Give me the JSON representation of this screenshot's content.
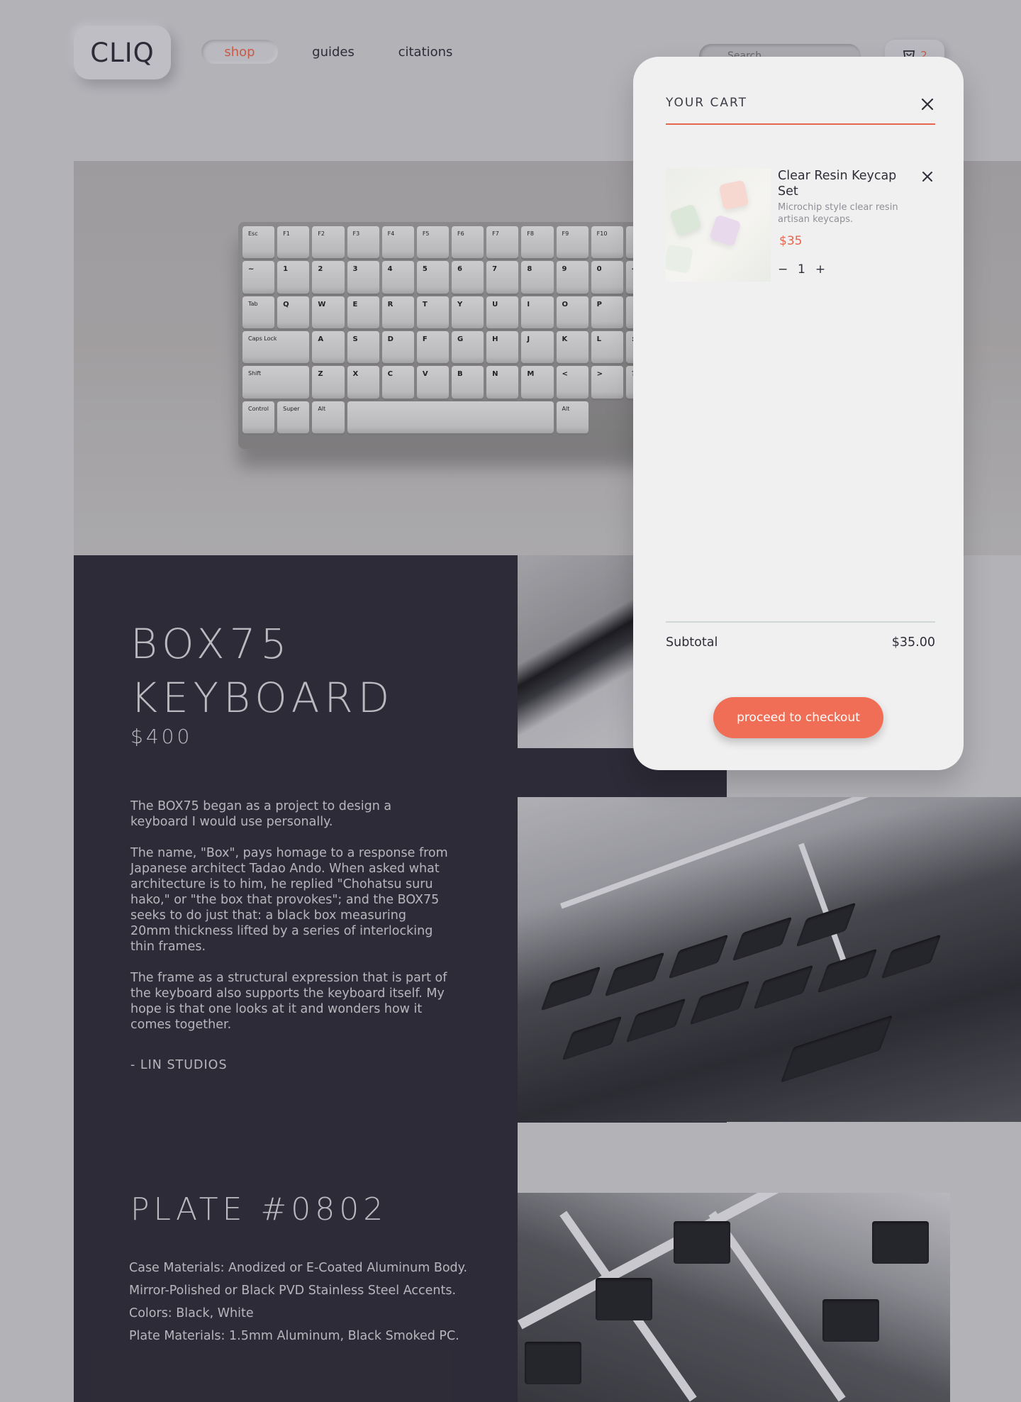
{
  "brand": {
    "logo_text": "CLIQ"
  },
  "nav": {
    "items": [
      {
        "label": "shop",
        "active": true
      },
      {
        "label": "guides",
        "active": false
      },
      {
        "label": "citations",
        "active": false
      }
    ]
  },
  "header": {
    "search_placeholder": "Search",
    "cart_count": "2"
  },
  "hero": {
    "keyboard_keys": {
      "row1": [
        "Esc",
        "F1",
        "F2",
        "F3",
        "F4",
        "F5",
        "F6",
        "F7",
        "F8",
        "F9",
        "F10",
        ""
      ],
      "row2": [
        "~",
        "1",
        "2",
        "3",
        "4",
        "5",
        "6",
        "7",
        "8",
        "9",
        "0",
        "-"
      ],
      "row3": [
        "Tab",
        "Q",
        "W",
        "E",
        "R",
        "T",
        "Y",
        "U",
        "I",
        "O",
        "P",
        ""
      ],
      "row4": [
        "Caps Lock",
        "A",
        "S",
        "D",
        "F",
        "G",
        "H",
        "J",
        "K",
        "L",
        ":"
      ],
      "row5": [
        "Shift",
        "Z",
        "X",
        "C",
        "V",
        "B",
        "N",
        "M",
        "<",
        ">",
        "?"
      ],
      "row6": [
        "Control",
        "Super",
        "Alt",
        "",
        "Alt"
      ]
    }
  },
  "product": {
    "title_line1": "BOX75",
    "title_line2": "KEYBOARD",
    "price": "$400",
    "paragraphs": [
      "The BOX75 began as a project to design a keyboard I would use personally.",
      "The name, \"Box\", pays homage to a response from Japanese architect Tadao Ando. When asked what architecture is to him, he replied \"Chohatsu suru hako,\" or \"the box that provokes\"; and the BOX75 seeks to do just that: a black box measuring 20mm thickness lifted by a series of interlocking thin frames.",
      "The frame as a structural expression that is part of the keyboard also supports the keyboard itself. My hope is that one looks at it and wonders how it comes together."
    ],
    "signoff": "- LIN STUDIOS"
  },
  "plate": {
    "title": "PLATE #0802",
    "specs": [
      "Case Materials: Anodized or E-Coated Aluminum Body.",
      "Mirror-Polished or Black PVD Stainless Steel Accents.",
      "Colors: Black, White",
      "Plate Materials: 1.5mm Aluminum, Black Smoked PC."
    ]
  },
  "cart": {
    "heading": "YOUR CART",
    "items": [
      {
        "name": "Clear Resin Keycap Set",
        "description": "Microchip style clear resin artisan keycaps.",
        "price": "$35",
        "quantity": "1"
      }
    ],
    "subtotal_label": "Subtotal",
    "subtotal_value": "$35.00",
    "checkout_label": "proceed to checkout"
  },
  "colors": {
    "accent": "#e7654d",
    "dark_panel": "#2f2d38",
    "page_bg": "#cdcdd1",
    "cart_bg": "#f0f0f1"
  }
}
